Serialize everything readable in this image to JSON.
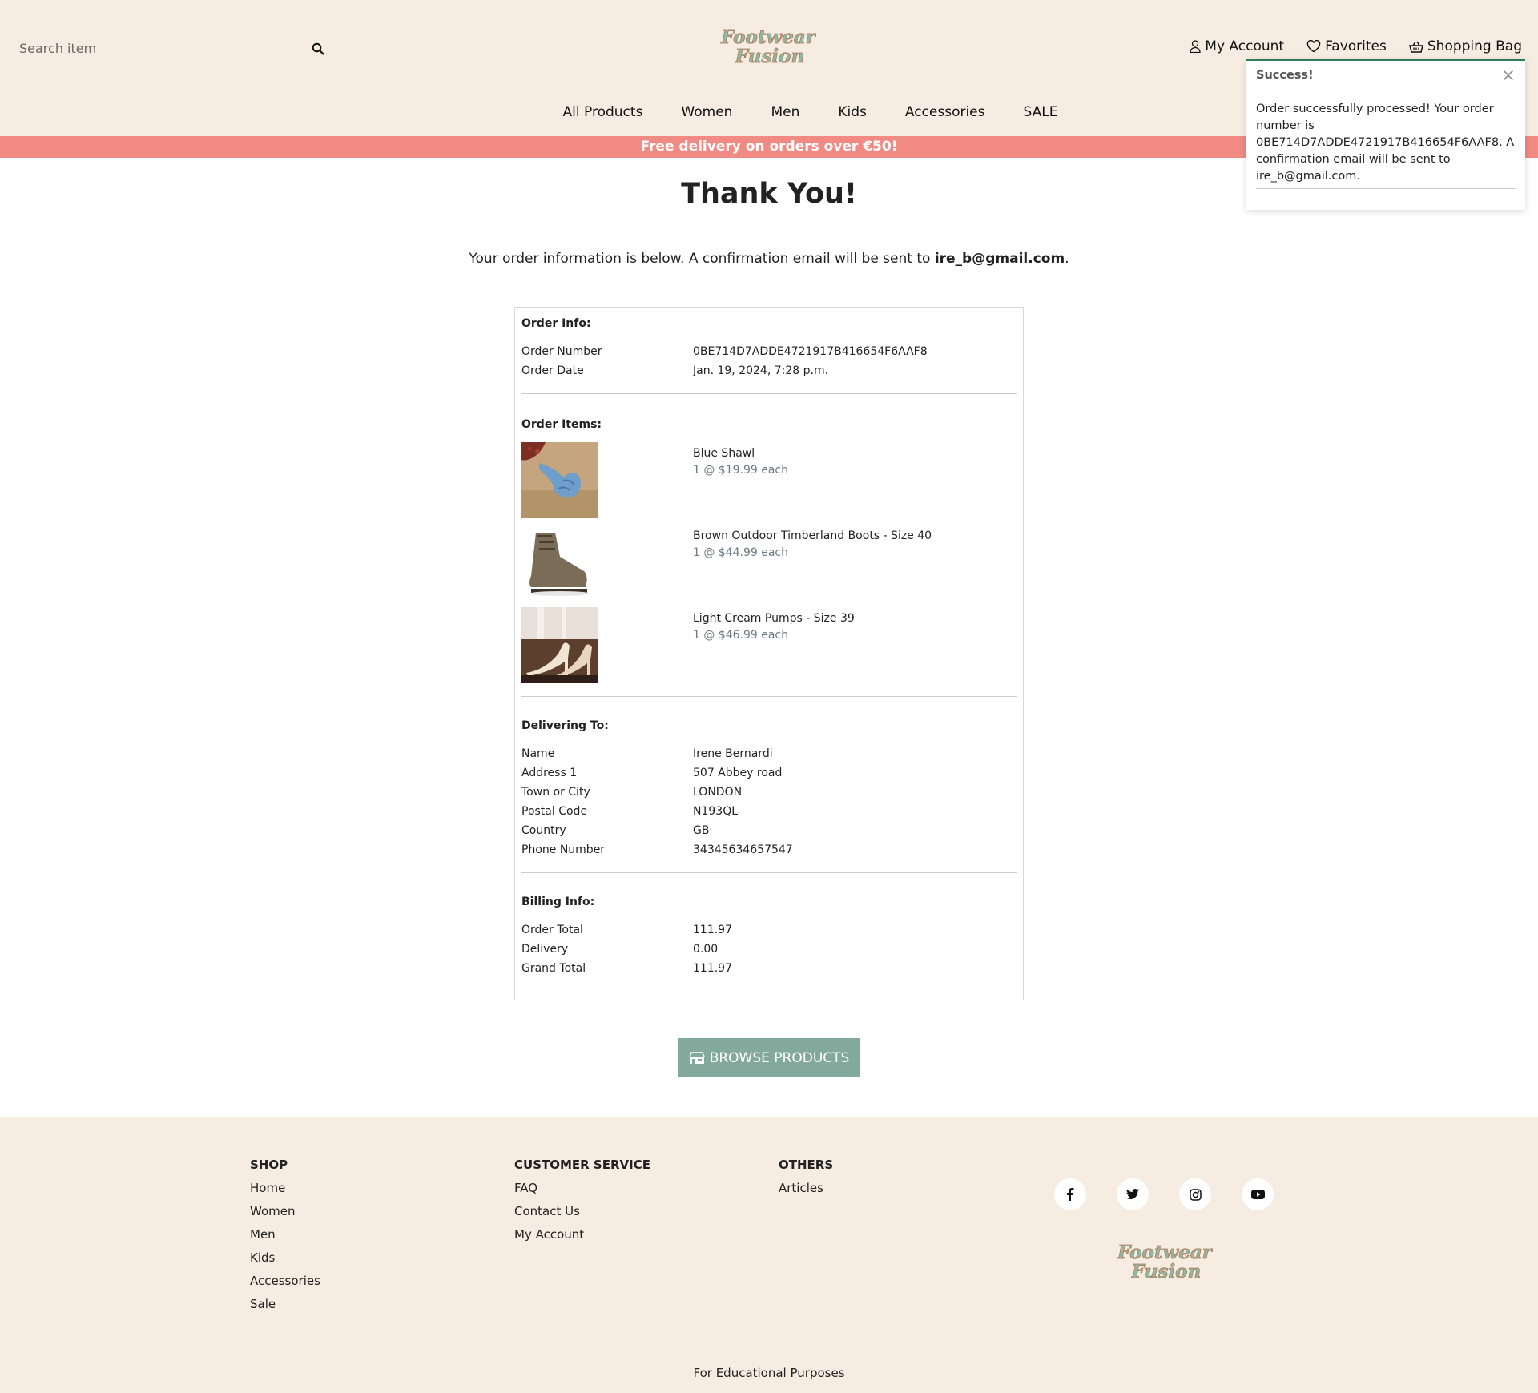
{
  "header": {
    "search": {
      "placeholder": "Search item"
    },
    "logo_text": {
      "line1": "Footwear",
      "line2": "Fusion"
    },
    "account_nav": [
      {
        "label": "My Account"
      },
      {
        "label": "Favorites"
      },
      {
        "label": "Shopping Bag"
      }
    ],
    "main_nav": [
      {
        "label": "All Products"
      },
      {
        "label": "Women"
      },
      {
        "label": "Men"
      },
      {
        "label": "Kids"
      },
      {
        "label": "Accessories"
      },
      {
        "label": "SALE"
      }
    ]
  },
  "banner": {
    "text": "Free delivery on orders over €50!"
  },
  "page": {
    "title": "Thank You!",
    "intro_prefix": "Your order information is below. A confirmation email will be sent to ",
    "intro_email": "ire_b@gmail.com",
    "intro_suffix": "."
  },
  "order": {
    "info_title": "Order Info:",
    "info": [
      {
        "k": "Order Number",
        "v": "0BE714D7ADDE4721917B416654F6AAF8"
      },
      {
        "k": "Order Date",
        "v": "Jan. 19, 2024, 7:28 p.m."
      }
    ],
    "items_title": "Order Items:",
    "items": [
      {
        "name": "Blue Shawl",
        "price": "1 @ $19.99 each"
      },
      {
        "name": "Brown Outdoor Timberland Boots - Size 40",
        "price": "1 @ $44.99 each"
      },
      {
        "name": "Light Cream Pumps - Size 39",
        "price": "1 @ $46.99 each"
      }
    ],
    "delivery_title": "Delivering To:",
    "delivery": [
      {
        "k": "Name",
        "v": "Irene Bernardi"
      },
      {
        "k": "Address 1",
        "v": "507 Abbey road"
      },
      {
        "k": "Town or City",
        "v": "LONDON"
      },
      {
        "k": "Postal Code",
        "v": "N193QL"
      },
      {
        "k": "Country",
        "v": "GB"
      },
      {
        "k": "Phone Number",
        "v": "34345634657547"
      }
    ],
    "billing_title": "Billing Info:",
    "billing": [
      {
        "k": "Order Total",
        "v": "111.97"
      },
      {
        "k": "Delivery",
        "v": "0.00"
      },
      {
        "k": "Grand Total",
        "v": "111.97"
      }
    ]
  },
  "browse_button": {
    "label": "BROWSE PRODUCTS"
  },
  "footer": {
    "shop": {
      "title": "SHOP",
      "links": [
        "Home",
        "Women",
        "Men",
        "Kids",
        "Accessories",
        "Sale"
      ]
    },
    "customer_service": {
      "title": "CUSTOMER SERVICE",
      "links": [
        "FAQ",
        "Contact Us",
        "My Account"
      ]
    },
    "others": {
      "title": "OTHERS",
      "links": [
        "Articles"
      ]
    },
    "social": [
      "facebook-icon",
      "twitter-icon",
      "instagram-icon",
      "youtube-icon"
    ],
    "note": "For Educational Purposes"
  },
  "toast": {
    "title": "Success!",
    "message": "Order successfully processed! Your order number is 0BE714D7ADDE4721917B416654F6AAF8. A confirmation email will be sent to ire_b@gmail.com."
  },
  "colors": {
    "header_bg": "#f7ece2",
    "banner": "#f08a82",
    "button": "#83a89c",
    "toast_accent": "#2e7d5a"
  }
}
